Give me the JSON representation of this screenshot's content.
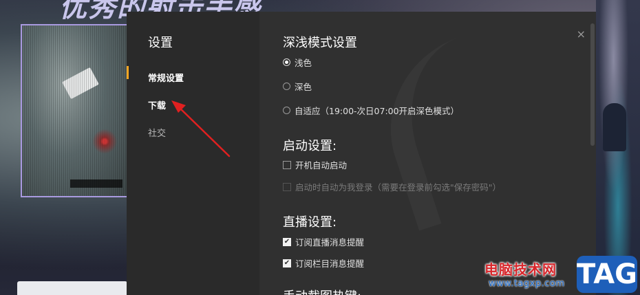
{
  "background": {
    "headline": "优秀的射击手感"
  },
  "dialog": {
    "title": "设置",
    "close_glyph": "×",
    "nav": [
      {
        "label": "常规设置"
      },
      {
        "label": "下载"
      },
      {
        "label": "社交"
      }
    ],
    "sections": {
      "theme": {
        "title": "深浅模式设置",
        "options": [
          {
            "label": "浅色",
            "checked": true
          },
          {
            "label": "深色",
            "checked": false
          },
          {
            "label": "自适应（19:00-次日07:00开启深色模式）",
            "checked": false
          }
        ]
      },
      "startup": {
        "title": "启动设置:",
        "options": [
          {
            "label": "开机自动启动",
            "checked": false,
            "disabled": false
          },
          {
            "label": "启动时自动为我登录（需要在登录前勾选\"保存密码\"）",
            "checked": false,
            "disabled": true
          }
        ]
      },
      "live": {
        "title": "直播设置:",
        "options": [
          {
            "label": "订阅直播消息提醒",
            "checked": true
          },
          {
            "label": "订阅栏目消息提醒",
            "checked": true
          }
        ]
      },
      "next": {
        "title": "手动截图热键:"
      }
    }
  },
  "watermark": {
    "site_name": "电脑技术网",
    "url": "www.tagxp.com",
    "badge": "TAG"
  },
  "colors": {
    "dialog_bg": "#303030",
    "sidebar_bg": "#2a2a2a",
    "accent": "#f5a623",
    "arrow": "#e02020",
    "watermark_red": "#d8262b",
    "watermark_blue": "#1e5fb9"
  }
}
